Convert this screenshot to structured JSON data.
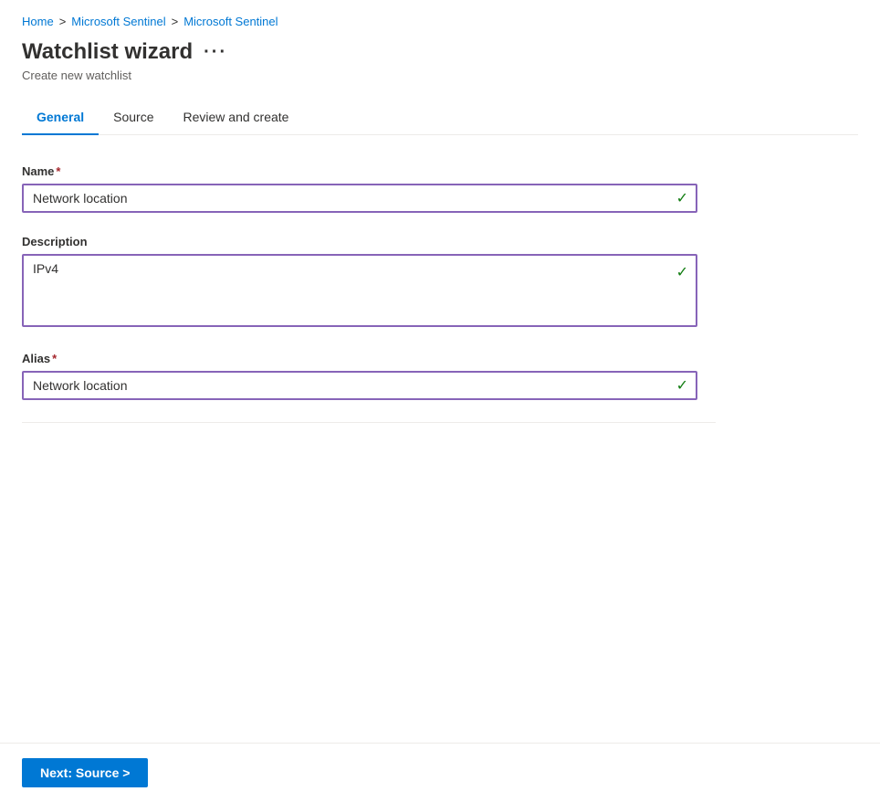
{
  "breadcrumb": {
    "items": [
      {
        "label": "Home",
        "href": "#"
      },
      {
        "label": "Microsoft Sentinel",
        "href": "#"
      },
      {
        "label": "Microsoft Sentinel",
        "href": "#"
      }
    ],
    "separator": ">"
  },
  "header": {
    "title": "Watchlist wizard",
    "more_options_label": "···",
    "subtitle": "Create new watchlist"
  },
  "tabs": [
    {
      "id": "general",
      "label": "General",
      "active": true
    },
    {
      "id": "source",
      "label": "Source",
      "active": false
    },
    {
      "id": "review",
      "label": "Review and create",
      "active": false
    }
  ],
  "form": {
    "name_label": "Name",
    "name_required": "*",
    "name_value": "Network location",
    "description_label": "Description",
    "description_value": "IPv4",
    "alias_label": "Alias",
    "alias_required": "*",
    "alias_value": "Network location"
  },
  "footer": {
    "next_button_label": "Next: Source >"
  }
}
